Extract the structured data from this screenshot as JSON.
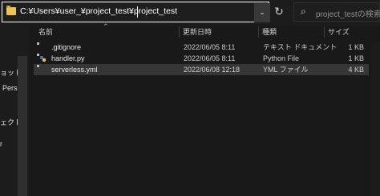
{
  "address_bar": {
    "path": "C:¥Users¥user_¥project_test¥project_test",
    "dropdown_glyph": "⌄",
    "refresh_glyph": "↻"
  },
  "search": {
    "placeholder": "project_testの検索",
    "icon_glyph": "⌕"
  },
  "navigation": {
    "items": [
      {
        "label": "ョット"
      },
      {
        "label": "Perso"
      },
      {
        "label": "ェクト"
      },
      {
        "label": "r"
      }
    ]
  },
  "columns": {
    "sort_glyph": "⌃",
    "name": "名前",
    "modified": "更新日時",
    "type": "種類",
    "size": "サイズ"
  },
  "files": [
    {
      "name": ".gitignore",
      "modified": "2022/06/05 8:11",
      "type": "テキスト ドキュメント",
      "size": "1 KB",
      "icon": "text-file-icon"
    },
    {
      "name": "handler.py",
      "modified": "2022/06/05 8:11",
      "type": "Python File",
      "size": "1 KB",
      "icon": "python-file-icon"
    },
    {
      "name": "serverless.yml",
      "modified": "2022/06/08 12:18",
      "type": "YML ファイル",
      "size": "4 KB",
      "icon": "yml-file-icon"
    }
  ],
  "colors": {
    "background": "#191919",
    "selected_row": "#363636",
    "folder": "#f0c44c"
  }
}
